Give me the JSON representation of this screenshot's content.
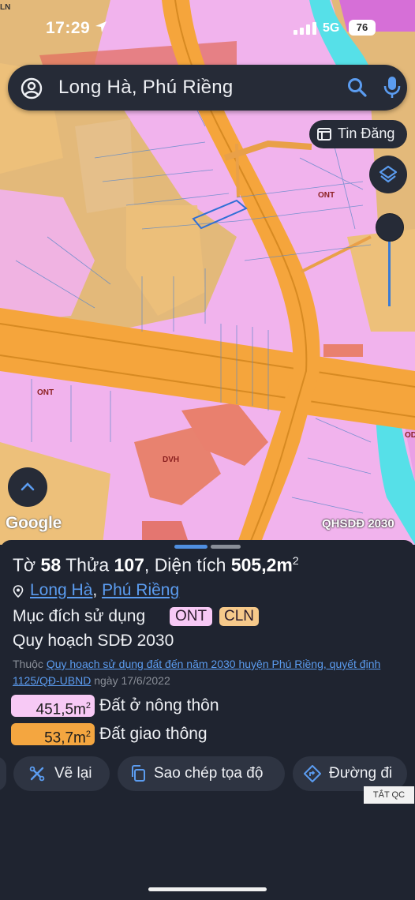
{
  "status_bar": {
    "time": "17:29",
    "network": "5G",
    "battery": "76"
  },
  "search": {
    "query": "Long Hà, Phú Riềng"
  },
  "map": {
    "tin_dang_label": "Tin Đăng",
    "zone_labels": [
      "ONT",
      "ONT",
      "DVH",
      "OD"
    ],
    "corner_label": "LN",
    "google_label": "Google",
    "layer_label": "QHSDĐ 2030"
  },
  "sheet": {
    "title_prefix": "Tờ",
    "sheet_no": "58",
    "parcel_word": "Thửa",
    "parcel_no": "107",
    "area_word": "Diện tích",
    "area_value": "505,2m",
    "area_unit_sup": "2",
    "location": {
      "link1": "Long Hà",
      "sep": ",",
      "link2": "Phú Riềng"
    },
    "purpose_label": "Mục đích sử dụng",
    "tags": [
      "ONT",
      "CLN"
    ],
    "plan_label": "Quy hoạch SDĐ 2030",
    "source": {
      "prefix": "Thuộc",
      "link": "Quy hoạch sử dụng đất đến năm 2030 huyện Phú Riềng, quyết định 1125/QĐ-UBND",
      "suffix": "ngày 17/6/2022"
    },
    "areas": [
      {
        "value": "451,5m",
        "sup": "2",
        "label": "Đất ở nông thôn",
        "color": "#f7c9f5"
      },
      {
        "value": "53,7m",
        "sup": "2",
        "label": "Đất giao thông",
        "color": "#f4a640"
      }
    ],
    "actions": {
      "redraw": "Vẽ lại",
      "copy_coords": "Sao chép tọa độ",
      "route": "Đường đi"
    },
    "ad_close": "TẮT QC"
  },
  "colors": {
    "residential_pink": "#f2b5ee",
    "agri_tan": "#edc07a",
    "road_orange": "#f5a53c",
    "culture_red": "#e9806e",
    "water_cyan": "#56e0e8",
    "accent_blue": "#5b9cf0"
  }
}
